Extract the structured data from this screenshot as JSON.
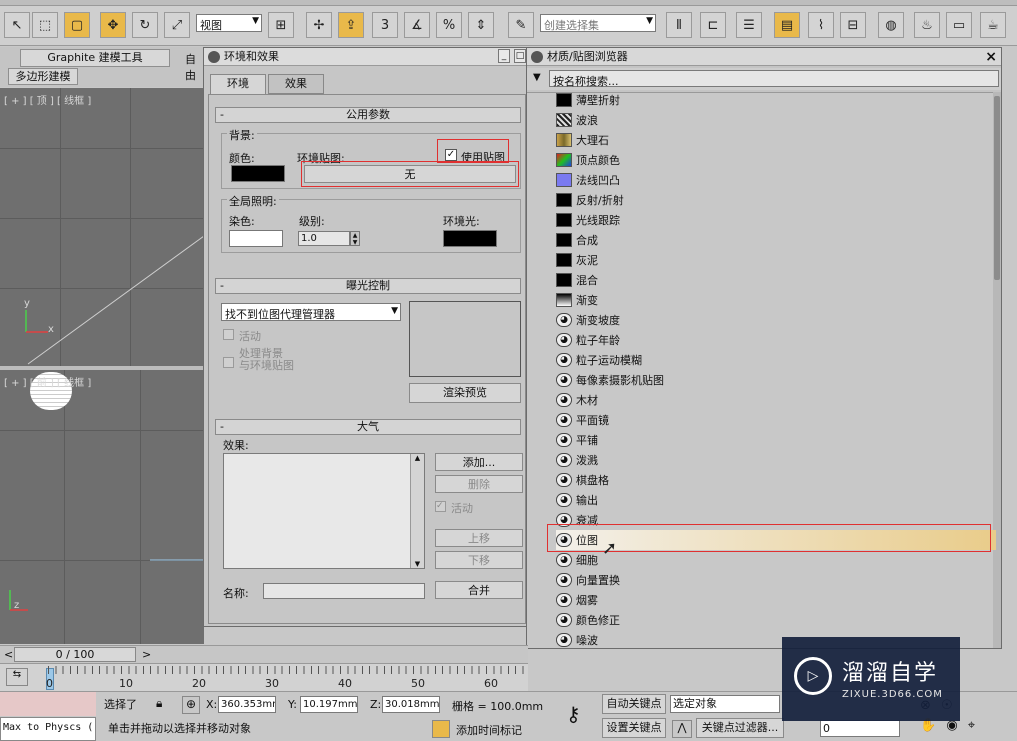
{
  "toolbar": {
    "view_dropdown": "视图",
    "selection_set_dropdown": "创建选择集",
    "snap_count": "3",
    "percent_snap": "%",
    "icons": [
      "select-icon",
      "rect-select-icon",
      "window-crossing-icon",
      "move-icon",
      "rotate-icon",
      "scale-icon",
      "pivot-icon",
      "manipulate-icon",
      "snap-icon",
      "angle-snap-icon",
      "percent-snap-icon",
      "spinner-snap-icon",
      "edit-named-sets-icon",
      "mirror-icon",
      "align-icon",
      "layer-icon",
      "curve-editor-icon",
      "schematic-icon",
      "material-editor-icon",
      "render-setup-icon",
      "render-frame-icon",
      "render-icon"
    ]
  },
  "ribbon": {
    "graphite_tab": "Graphite 建模工具",
    "freeform_tab": "自由",
    "poly_tab": "多边形建模"
  },
  "viewports": {
    "top_label": "[ + ] [ 顶 ] [ 线框 ]",
    "front_label": "[ + ] [ 前 ] [ 线框 ]",
    "axis_y": "y",
    "axis_x": "x",
    "axis_z": "z"
  },
  "env_dialog": {
    "title": "环境和效果",
    "tabs": [
      "环境",
      "效果"
    ],
    "common_params": {
      "header": "公用参数",
      "background_label": "背景:",
      "color_label": "颜色:",
      "env_map_label": "环境贴图:",
      "use_map_label": "使用贴图",
      "use_map_checked": true,
      "map_button": "无",
      "global_lighting_label": "全局照明:",
      "tint_label": "染色:",
      "level_label": "级别:",
      "level_value": "1.0",
      "ambient_label": "环境光:",
      "bg_color": "#000000",
      "tint_color": "#ffffff",
      "ambient_color": "#000000"
    },
    "exposure": {
      "header": "曝光控制",
      "dropdown_value": "找不到位图代理管理器",
      "active_label": "活动",
      "process_bg_label_1": "处理背景",
      "process_bg_label_2": "与环境贴图",
      "render_preview_button": "渲染预览"
    },
    "atmosphere": {
      "header": "大气",
      "effects_label": "效果:",
      "add_button": "添加...",
      "delete_button": "删除",
      "active_label": "活动",
      "move_up_button": "上移",
      "move_down_button": "下移",
      "name_label": "名称:",
      "name_value": "",
      "merge_button": "合并"
    }
  },
  "browser": {
    "title": "材质/贴图浏览器",
    "search_placeholder": "按名称搜索...",
    "items": [
      {
        "label": "薄壁折射",
        "icon": "black-swatch"
      },
      {
        "label": "波浪",
        "icon": "checker-swatch"
      },
      {
        "label": "大理石",
        "icon": "marble-swatch"
      },
      {
        "label": "顶点颜色",
        "icon": "vertex-color-swatch"
      },
      {
        "label": "法线凹凸",
        "icon": "normal-bump-swatch"
      },
      {
        "label": "反射/折射",
        "icon": "black-swatch"
      },
      {
        "label": "光线跟踪",
        "icon": "black-swatch"
      },
      {
        "label": "合成",
        "icon": "black-swatch"
      },
      {
        "label": "灰泥",
        "icon": "black-swatch"
      },
      {
        "label": "混合",
        "icon": "black-swatch"
      },
      {
        "label": "渐变",
        "icon": "gradient-swatch"
      },
      {
        "label": "渐变坡度",
        "icon": "map-icon"
      },
      {
        "label": "粒子年龄",
        "icon": "map-icon"
      },
      {
        "label": "粒子运动模糊",
        "icon": "map-icon"
      },
      {
        "label": "每像素摄影机贴图",
        "icon": "map-icon"
      },
      {
        "label": "木材",
        "icon": "map-icon"
      },
      {
        "label": "平面镜",
        "icon": "map-icon"
      },
      {
        "label": "平铺",
        "icon": "map-icon"
      },
      {
        "label": "泼溅",
        "icon": "map-icon"
      },
      {
        "label": "棋盘格",
        "icon": "map-icon"
      },
      {
        "label": "输出",
        "icon": "map-icon"
      },
      {
        "label": "衰减",
        "icon": "map-icon"
      },
      {
        "label": "位图",
        "icon": "map-icon",
        "selected": true
      },
      {
        "label": "细胞",
        "icon": "map-icon"
      },
      {
        "label": "向量置换",
        "icon": "map-icon"
      },
      {
        "label": "烟雾",
        "icon": "map-icon"
      },
      {
        "label": "颜色修正",
        "icon": "map-icon"
      },
      {
        "label": "噪波",
        "icon": "map-icon"
      }
    ]
  },
  "timeline": {
    "frame_counter": "0 / 100",
    "ticks": [
      "0",
      "10",
      "20",
      "30",
      "40",
      "50",
      "60"
    ]
  },
  "status": {
    "max_to_physx": "Max to Physcs (",
    "selected_label": "选择了",
    "x_label": "X:",
    "x_value": "360.353mr",
    "y_label": "Y:",
    "y_value": "10.197mm",
    "z_label": "Z:",
    "z_value": "30.018mm",
    "grid_label": "栅格 = 100.0mm",
    "prompt": "单击并拖动以选择并移动对象",
    "add_time_tag": "添加时间标记",
    "auto_key": "自动关键点",
    "set_key": "设置关键点",
    "selected_object": "选定对象",
    "key_filters": "关键点过滤器...",
    "frame_value": "0"
  },
  "watermark": {
    "brand": "溜溜自学",
    "url": "ZIXUE.3D66.COM"
  }
}
